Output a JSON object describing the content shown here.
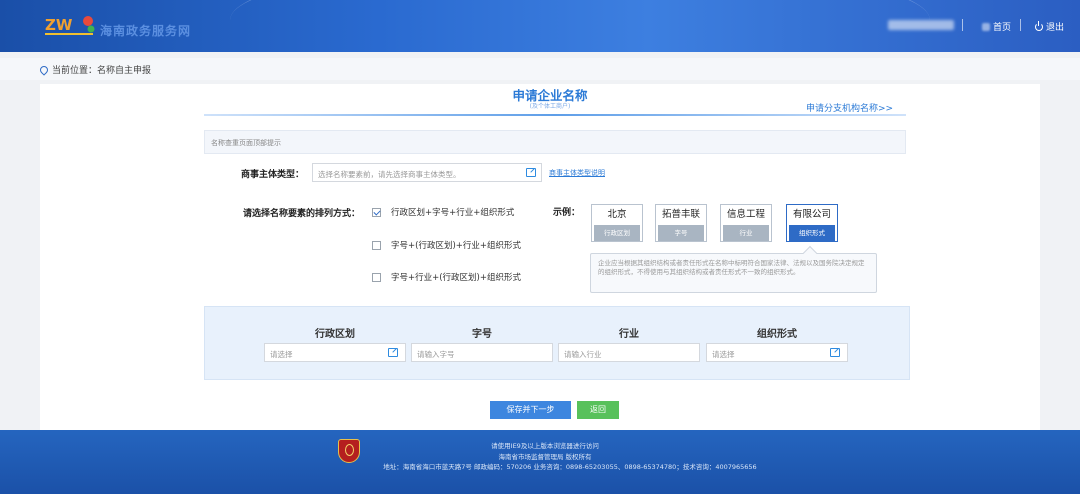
{
  "header": {
    "logo_text": "海南政务服务网",
    "user_name": "",
    "home_label": "首页",
    "logout_label": "退出"
  },
  "breadcrumb": {
    "prefix": "当前位置：",
    "current": "名称自主申报"
  },
  "page": {
    "title": "申请企业名称",
    "subtitle": "(及个体工商户)",
    "branch_link": "申请分支机构名称>>",
    "notice": "名称查重页面顶部提示"
  },
  "entity_type": {
    "label": "商事主体类型：",
    "placeholder": "选择名称要素前，请先选择商事主体类型。",
    "help_link": "商事主体类型说明"
  },
  "order": {
    "label": "请选择名称要素的排列方式：",
    "options": [
      {
        "label": "行政区划+字号+行业+组织形式",
        "checked": true
      },
      {
        "label": "字号+(行政区划)+行业+组织形式",
        "checked": false
      },
      {
        "label": "字号+行业+(行政区划)+组织形式",
        "checked": false
      }
    ]
  },
  "example": {
    "label": "示例：",
    "items": [
      {
        "word": "北京",
        "tag": "行政区划",
        "selected": false
      },
      {
        "word": "拓普丰联",
        "tag": "字号",
        "selected": false
      },
      {
        "word": "信息工程",
        "tag": "行业",
        "selected": false
      },
      {
        "word": "有限公司",
        "tag": "组织形式",
        "selected": true
      }
    ],
    "tip": "企业应当根据其组织结构或者责任形式在名称中标明符合国家法律、法规以及国务院决定规定的组织形式，不得使用与其组织结构或者责任形式不一致的组织形式。"
  },
  "fields": [
    {
      "header": "行政区划",
      "placeholder": "请选择",
      "has_picker": true
    },
    {
      "header": "字号",
      "placeholder": "请输入字号",
      "has_picker": false
    },
    {
      "header": "行业",
      "placeholder": "请输入行业",
      "has_picker": false
    },
    {
      "header": "组织形式",
      "placeholder": "请选择",
      "has_picker": true
    }
  ],
  "buttons": {
    "save_next": "保存并下一步",
    "back": "返回"
  },
  "footer": {
    "line1": "请使用IE9及以上版本浏览器进行访问",
    "line2": "海南省市场监督管理局 版权所有",
    "line3": "地址：海南省海口市蓝天路7号 邮政编码：570206 业务咨询：0898-65203055、0898-65374780；技术咨询：4007965656"
  },
  "colors": {
    "primary": "#2b7ad6",
    "header_bg": "#2a6ad0",
    "button_blue": "#3d86df",
    "button_green": "#58c15b",
    "footer_bg": "#1f58b2"
  }
}
